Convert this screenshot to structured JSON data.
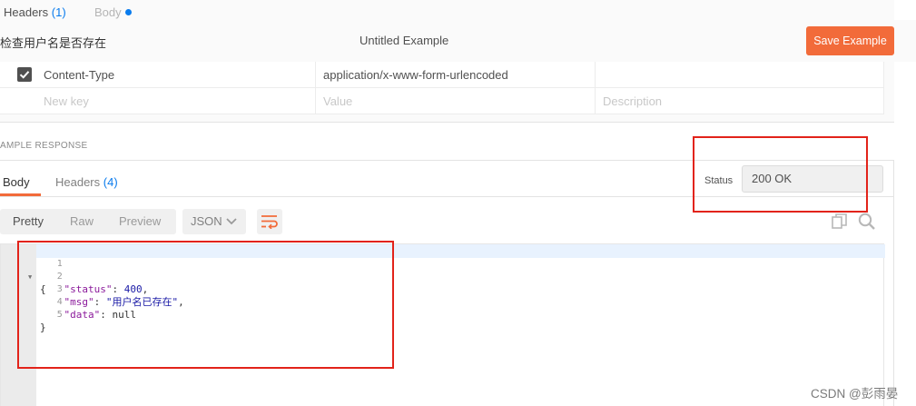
{
  "top_tabs": {
    "headers_label": "Headers",
    "headers_count": "(1)",
    "body_label": "Body"
  },
  "modal": {
    "example_name": "检查用户名是否存在",
    "title": "Untitled Example",
    "save_label": "Save Example"
  },
  "request_headers": {
    "rows": [
      {
        "key": "Content-Type",
        "value": "application/x-www-form-urlencoded",
        "description": "",
        "checked": true
      }
    ],
    "placeholders": {
      "key": "New key",
      "value": "Value",
      "description": "Description"
    }
  },
  "sample_response": {
    "section_label": "AMPLE RESPONSE",
    "tabs": [
      {
        "label": "Body",
        "count": ""
      },
      {
        "label": "Headers",
        "count": "(4)"
      }
    ],
    "status_label": "Status",
    "status_value": "200 OK",
    "format_buttons": [
      "Pretty",
      "Raw",
      "Preview"
    ],
    "language": "JSON",
    "code_lines": [
      {
        "num": "1",
        "text": "{"
      },
      {
        "num": "2",
        "key": "\"status\"",
        "value": "400",
        "suffix": ","
      },
      {
        "num": "3",
        "key": "\"msg\"",
        "value": "\"用户名已存在\"",
        "suffix": ","
      },
      {
        "num": "4",
        "key": "\"data\"",
        "value": "null",
        "suffix": ""
      },
      {
        "num": "5",
        "text": "}"
      }
    ]
  },
  "watermark": "CSDN @彭雨晏",
  "colors": {
    "accent": "#f26b3a",
    "link_blue": "#097bed",
    "highlight_red": "#e2231a"
  },
  "icons": [
    "chevron-down-icon",
    "wrap-lines-icon",
    "copy-icon",
    "search-icon",
    "checkmark-icon",
    "fold-arrow-icon"
  ]
}
